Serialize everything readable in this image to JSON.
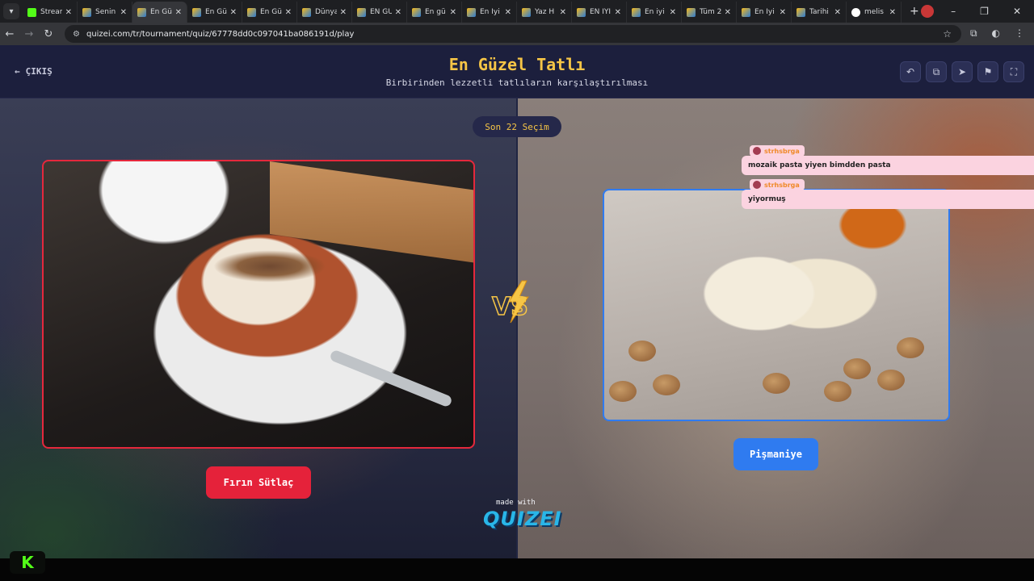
{
  "browser": {
    "tabs": [
      {
        "title": "Stream",
        "favicon": "kick"
      },
      {
        "title": "Senin",
        "favicon": "quizei"
      },
      {
        "title": "En Gü",
        "favicon": "quizei",
        "active": true
      },
      {
        "title": "En Gü",
        "favicon": "quizei"
      },
      {
        "title": "En Gü",
        "favicon": "quizei"
      },
      {
        "title": "Dünya",
        "favicon": "quizei"
      },
      {
        "title": "EN GÜ",
        "favicon": "quizei"
      },
      {
        "title": "En gü",
        "favicon": "quizei"
      },
      {
        "title": "En İyi",
        "favicon": "quizei"
      },
      {
        "title": "Yaz H",
        "favicon": "quizei"
      },
      {
        "title": "EN İYİ",
        "favicon": "quizei"
      },
      {
        "title": "En iyi",
        "favicon": "quizei"
      },
      {
        "title": "Tüm 2",
        "favicon": "quizei"
      },
      {
        "title": "En İyi",
        "favicon": "quizei"
      },
      {
        "title": "Tarihi",
        "favicon": "quizei"
      },
      {
        "title": "melis",
        "favicon": "google"
      }
    ],
    "url": "quizei.com/tr/tournament/quiz/67778dd0c097041ba086191d/play"
  },
  "header": {
    "exit_label": "ÇIKIŞ",
    "title": "En Güzel Tatlı",
    "subtitle": "Birbirinden lezzetli tatlıların karşılaştırılması",
    "buttons": [
      "undo-icon",
      "copy-icon",
      "share-icon",
      "flag-icon",
      "fullscreen-icon"
    ]
  },
  "round": {
    "label": "Son 22 Seçim"
  },
  "left": {
    "name": "Fırın Sütlaç",
    "accent": "#e5223a"
  },
  "right": {
    "name": "Pişmaniye",
    "accent": "#2f7bf0"
  },
  "vs_label": "VS",
  "footer": {
    "made_with": "made with",
    "brand": "QUIZEI"
  },
  "chat": [
    {
      "user": "strhsbrga",
      "message": "mozaik pasta yiyen bimdden pasta"
    },
    {
      "user": "strhsbrga",
      "message": "yiyormuş"
    }
  ]
}
